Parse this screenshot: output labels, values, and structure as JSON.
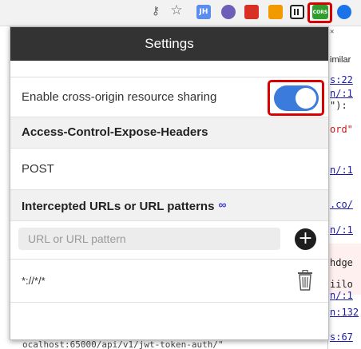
{
  "toolbar": {
    "icons": [
      "key-icon",
      "bookmark-star-icon",
      "jh-extension-icon",
      "b-extension-icon",
      "bug-extension-icon",
      "square-extension-icon",
      "qr-extension-icon",
      "cors-extension-icon",
      "globe-extension-icon"
    ],
    "jh_label": "JH",
    "cors_label": "CORS"
  },
  "popup": {
    "title": "Settings",
    "cors_label": "Enable cross-origin resource sharing",
    "cors_enabled": true,
    "expose_headers_title": "Access-Control-Expose-Headers",
    "expose_headers_value": "POST",
    "intercepted_title": "Intercepted URLs or URL patterns",
    "url_input_placeholder": "URL or URL pattern",
    "url_input_value": "",
    "patterns": [
      "*://*/*"
    ]
  },
  "devtools": {
    "lines": [
      "imilar",
      "s:22",
      "n/:1",
      "\"):",
      "ord\"",
      "n/:1",
      ".co/",
      "n/:1",
      "hdge",
      "iilo",
      "n/:1",
      "n:132",
      "s:67"
    ],
    "bottom": "ocalhost:65000/api/v1/jwt-token-auth/\""
  },
  "colors": {
    "header_bg": "#333333",
    "toggle_on": "#3b7bdc",
    "highlight": "#d90000",
    "section_bg": "#f1f1f1"
  }
}
